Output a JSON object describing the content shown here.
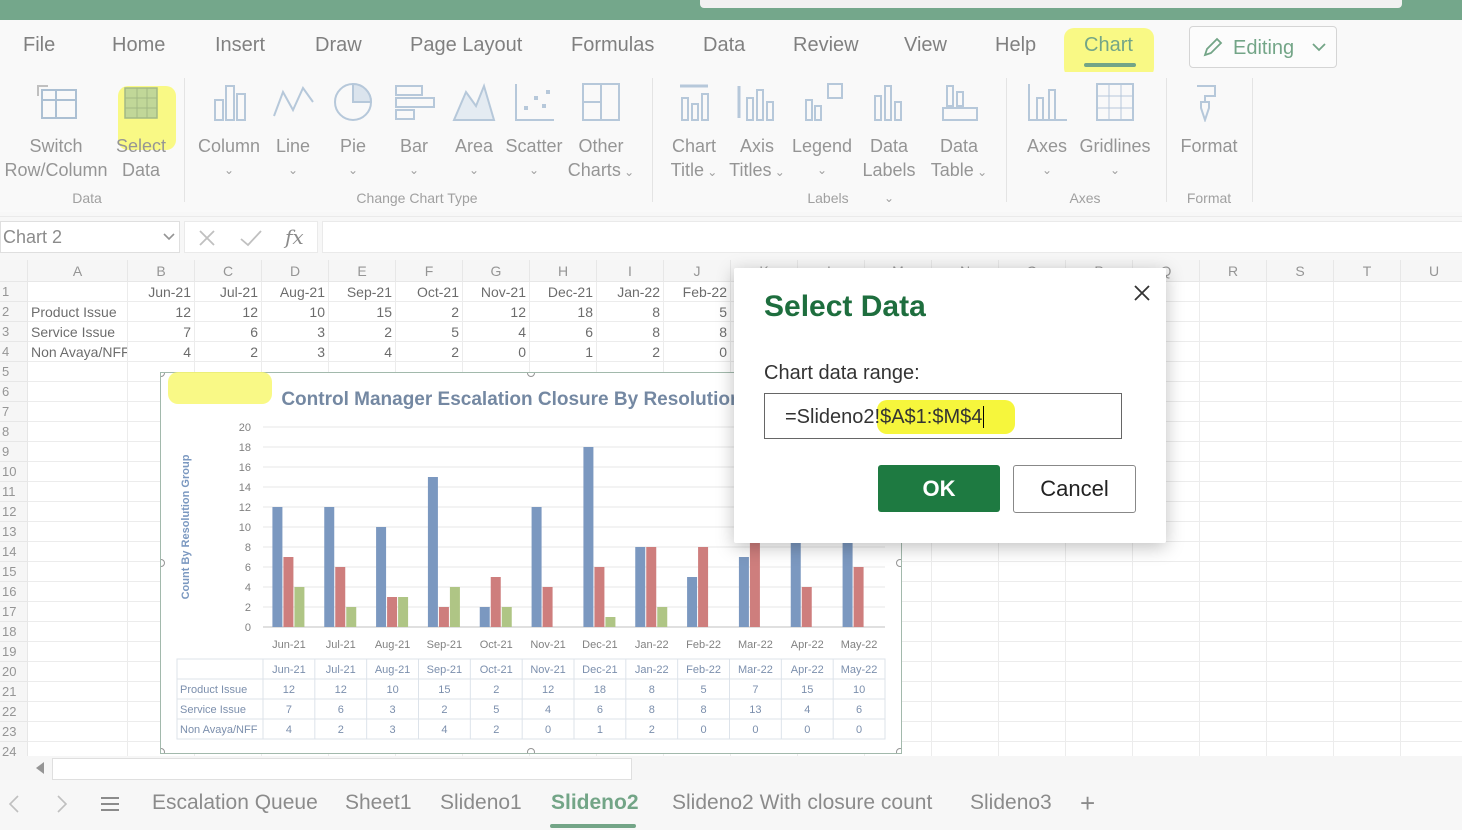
{
  "menu": {
    "items": [
      "File",
      "Home",
      "Insert",
      "Draw",
      "Page Layout",
      "Formulas",
      "Data",
      "Review",
      "View",
      "Help"
    ],
    "chart_tab": "Chart",
    "editing": "Editing"
  },
  "ribbon": {
    "data_group": {
      "switch_label": "Switch",
      "switch_label2": "Row/Column",
      "select_label": "Select",
      "select_label2": "Data",
      "group": "Data"
    },
    "type_group": {
      "column": "Column",
      "line": "Line",
      "pie": "Pie",
      "bar": "Bar",
      "area": "Area",
      "scatter": "Scatter",
      "other1": "Other",
      "other2": "Charts",
      "group": "Change Chart Type"
    },
    "labels_group": {
      "chart1": "Chart",
      "chart2": "Title",
      "axis1": "Axis",
      "axis2": "Titles",
      "legend": "Legend",
      "dl1": "Data",
      "dl2": "Labels",
      "dt1": "Data",
      "dt2": "Table",
      "group": "Labels"
    },
    "axes_group": {
      "axes": "Axes",
      "gridlines": "Gridlines",
      "group": "Axes"
    },
    "format_group": {
      "format": "Format",
      "group": "Format"
    }
  },
  "formula_bar": {
    "name_box": "Chart 2",
    "fx": "fx"
  },
  "sheet": {
    "col_headers": [
      "A",
      "B",
      "C",
      "D",
      "E",
      "F",
      "G",
      "H",
      "I",
      "J",
      "K",
      "L",
      "M",
      "N",
      "O",
      "P",
      "Q",
      "R",
      "S",
      "T",
      "U"
    ],
    "row_headers": [
      "1",
      "2",
      "3",
      "4",
      "5",
      "6",
      "7",
      "8",
      "9",
      "10",
      "11",
      "12",
      "13",
      "14",
      "15",
      "16",
      "17",
      "18",
      "19",
      "20",
      "21",
      "22",
      "23",
      "24"
    ],
    "header_row": [
      "Jun-21",
      "Jul-21",
      "Aug-21",
      "Sep-21",
      "Oct-21",
      "Nov-21",
      "Dec-21",
      "Jan-22",
      "Feb-22"
    ],
    "rows": [
      {
        "label": "Product Issue",
        "values": [
          "12",
          "12",
          "10",
          "15",
          "2",
          "12",
          "18",
          "8",
          "5"
        ]
      },
      {
        "label": "Service Issue",
        "values": [
          "7",
          "6",
          "3",
          "2",
          "5",
          "4",
          "6",
          "8",
          "8"
        ]
      },
      {
        "label": "Non Avaya/NFF",
        "values": [
          "4",
          "2",
          "3",
          "4",
          "2",
          "0",
          "1",
          "2",
          "0"
        ]
      }
    ]
  },
  "chart_data": {
    "type": "bar",
    "title": "Control Manager Escalation Closure By Resolution Gro",
    "ylabel": "Count By Resolution Group",
    "xlabel": "",
    "ylim": [
      0,
      20
    ],
    "yticks": [
      "0",
      "2",
      "4",
      "6",
      "8",
      "10",
      "12",
      "14",
      "16",
      "18",
      "20"
    ],
    "categories": [
      "Jun-21",
      "Jul-21",
      "Aug-21",
      "Sep-21",
      "Oct-21",
      "Nov-21",
      "Dec-21",
      "Jan-22",
      "Feb-22",
      "Mar-22",
      "Apr-22",
      "May-22"
    ],
    "series": [
      {
        "name": "Product Issue",
        "color": "#2a5a9a",
        "values": [
          12,
          12,
          10,
          15,
          2,
          12,
          18,
          8,
          5,
          7,
          15,
          10
        ]
      },
      {
        "name": "Service Issue",
        "color": "#b0302e",
        "values": [
          7,
          6,
          3,
          2,
          5,
          4,
          6,
          8,
          8,
          13,
          4,
          6
        ]
      },
      {
        "name": "Non Avaya/NFF",
        "color": "#7fa23a",
        "values": [
          4,
          2,
          3,
          4,
          2,
          0,
          1,
          2,
          0,
          0,
          0,
          0
        ]
      }
    ],
    "table": {
      "rows": [
        {
          "label": "Product Issue",
          "values": [
            "12",
            "12",
            "10",
            "15",
            "2",
            "12",
            "18",
            "8",
            "5",
            "7",
            "15",
            "10"
          ]
        },
        {
          "label": "Service Issue",
          "values": [
            "7",
            "6",
            "3",
            "2",
            "5",
            "4",
            "6",
            "8",
            "8",
            "13",
            "4",
            "6"
          ]
        },
        {
          "label": "Non Avaya/NFF",
          "values": [
            "4",
            "2",
            "3",
            "4",
            "2",
            "0",
            "1",
            "2",
            "0",
            "0",
            "0",
            "0"
          ]
        }
      ]
    },
    "grid": true,
    "legend": "data-table"
  },
  "dialog": {
    "title": "Select Data",
    "label": "Chart data range:",
    "value_prefix": "=Slideno2",
    "value_highlight": "!$A$1:$M$4",
    "ok": "OK",
    "cancel": "Cancel"
  },
  "tabs": {
    "items": [
      "Escalation Queue",
      "Sheet1",
      "Slideno1",
      "Slideno2",
      "Slideno2 With closure count",
      "Slideno3"
    ],
    "active": "Slideno2",
    "add": "+"
  },
  "colors": {
    "accent": "#1e6e3e",
    "highlight": "#f4f41a"
  }
}
